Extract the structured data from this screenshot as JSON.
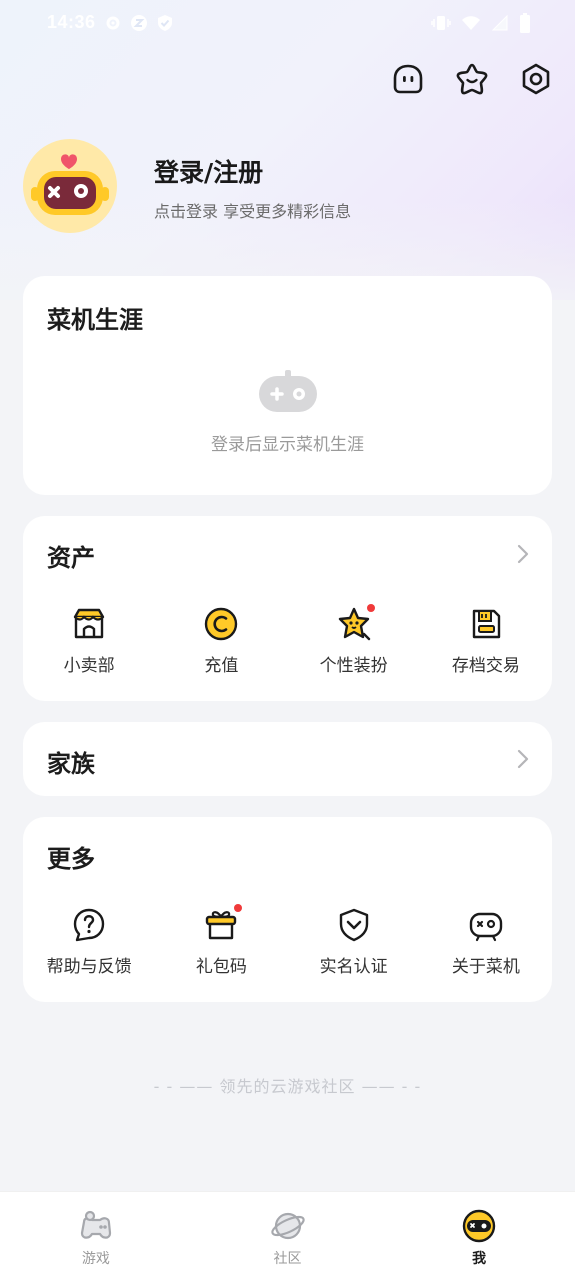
{
  "status_bar": {
    "time": "14:36"
  },
  "profile": {
    "title": "登录/注册",
    "subtitle": "点击登录 享受更多精彩信息"
  },
  "career": {
    "title": "菜机生涯",
    "empty_text": "登录后显示菜机生涯"
  },
  "assets": {
    "title": "资产",
    "items": [
      {
        "label": "小卖部",
        "icon": "shop-icon"
      },
      {
        "label": "充值",
        "icon": "coin-icon"
      },
      {
        "label": "个性装扮",
        "icon": "star-dressup-icon",
        "badge": true
      },
      {
        "label": "存档交易",
        "icon": "save-file-icon"
      }
    ]
  },
  "family": {
    "title": "家族"
  },
  "more": {
    "title": "更多",
    "items": [
      {
        "label": "帮助与反馈",
        "icon": "help-icon"
      },
      {
        "label": "礼包码",
        "icon": "gift-icon",
        "badge": true
      },
      {
        "label": "实名认证",
        "icon": "shield-check-icon"
      },
      {
        "label": "关于菜机",
        "icon": "gamepad-face-icon"
      }
    ]
  },
  "slogan": "领先的云游戏社区",
  "tabbar": {
    "items": [
      {
        "label": "游戏",
        "icon": "game-tab-icon"
      },
      {
        "label": "社区",
        "icon": "planet-tab-icon"
      },
      {
        "label": "我",
        "icon": "me-tab-icon",
        "active": true
      }
    ]
  },
  "colors": {
    "accent_yellow": "#ffc928",
    "avatar_bg": "#ffe9a8",
    "avatar_dark": "#7a2a3a",
    "badge_red": "#f03a3a",
    "icon_dark": "#1a1a1a"
  }
}
